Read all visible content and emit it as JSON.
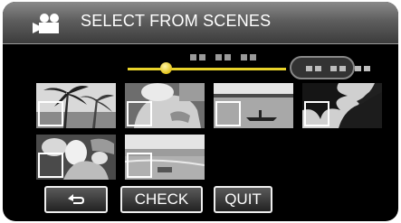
{
  "header": {
    "title": "SELECT FROM SCENES",
    "icon": "video-camera-icon"
  },
  "slider": {
    "position_fraction": 0.2
  },
  "thumbnails": [
    {
      "scene": "palm-trees"
    },
    {
      "scene": "person-closeup"
    },
    {
      "scene": "boat-on-water"
    },
    {
      "scene": "dark-palm-silhouette"
    },
    {
      "scene": "people-group"
    },
    {
      "scene": "beach-shore"
    }
  ],
  "buttons": {
    "back_icon": "return-arrow-icon",
    "check_label": "CHECK",
    "quit_label": "QUIT"
  },
  "colors": {
    "slider": "#e8d22a",
    "background": "#000000",
    "header": "#5e5e5e"
  }
}
